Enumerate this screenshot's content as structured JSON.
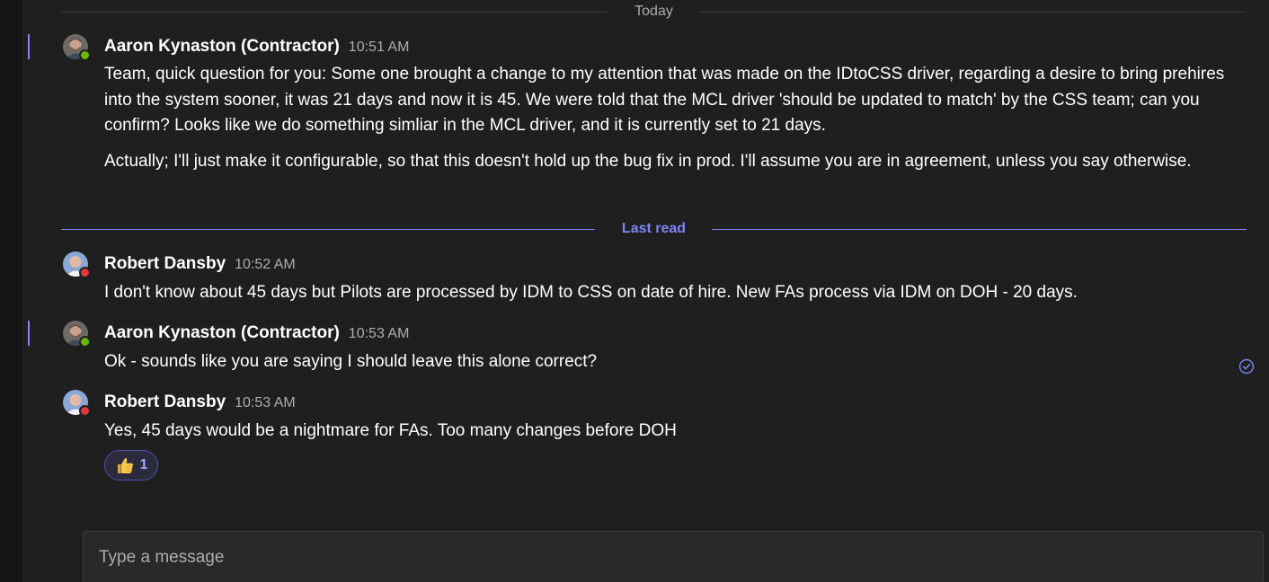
{
  "dividers": {
    "today": "Today",
    "last_read": "Last read"
  },
  "colors": {
    "accent": "#7f85f5",
    "background": "#1f1f1f",
    "presence_available": "#6bb700",
    "presence_busy": "#e0383b"
  },
  "messages": [
    {
      "author": "Aaron Kynaston (Contractor)",
      "time": "10:51 AM",
      "presence": "available",
      "paragraphs": [
        "Team, quick question for you: Some one brought a change to my attention that was made on the IDtoCSS driver, regarding a desire to bring prehires into the system sooner, it was 21 days and now it is 45.  We were told that the MCL driver 'should be updated to match' by the CSS team; can you confirm? Looks like we do something simliar in the MCL driver, and it is currently set to 21 days.",
        "Actually; I'll just make it configurable, so that this doesn't hold up the bug fix in prod. I'll assume you are in agreement, unless you say otherwise."
      ]
    },
    {
      "author": "Robert Dansby",
      "time": "10:52 AM",
      "presence": "busy",
      "paragraphs": [
        "I don't know about 45 days but Pilots are processed by IDM to CSS on date of hire.  New FAs process via IDM on DOH - 20 days."
      ]
    },
    {
      "author": "Aaron Kynaston (Contractor)",
      "time": "10:53 AM",
      "presence": "available",
      "paragraphs": [
        "Ok - sounds like you are saying I should leave this alone correct?"
      ],
      "read_receipt_icon": "check-circle-icon"
    },
    {
      "author": "Robert Dansby",
      "time": "10:53 AM",
      "presence": "busy",
      "paragraphs": [
        "Yes, 45 days would be a nightmare for FAs.  Too many changes before DOH"
      ],
      "reaction": {
        "icon": "thumbs-up-icon",
        "count": "1"
      }
    }
  ],
  "compose": {
    "placeholder": "Type a message",
    "value": ""
  }
}
